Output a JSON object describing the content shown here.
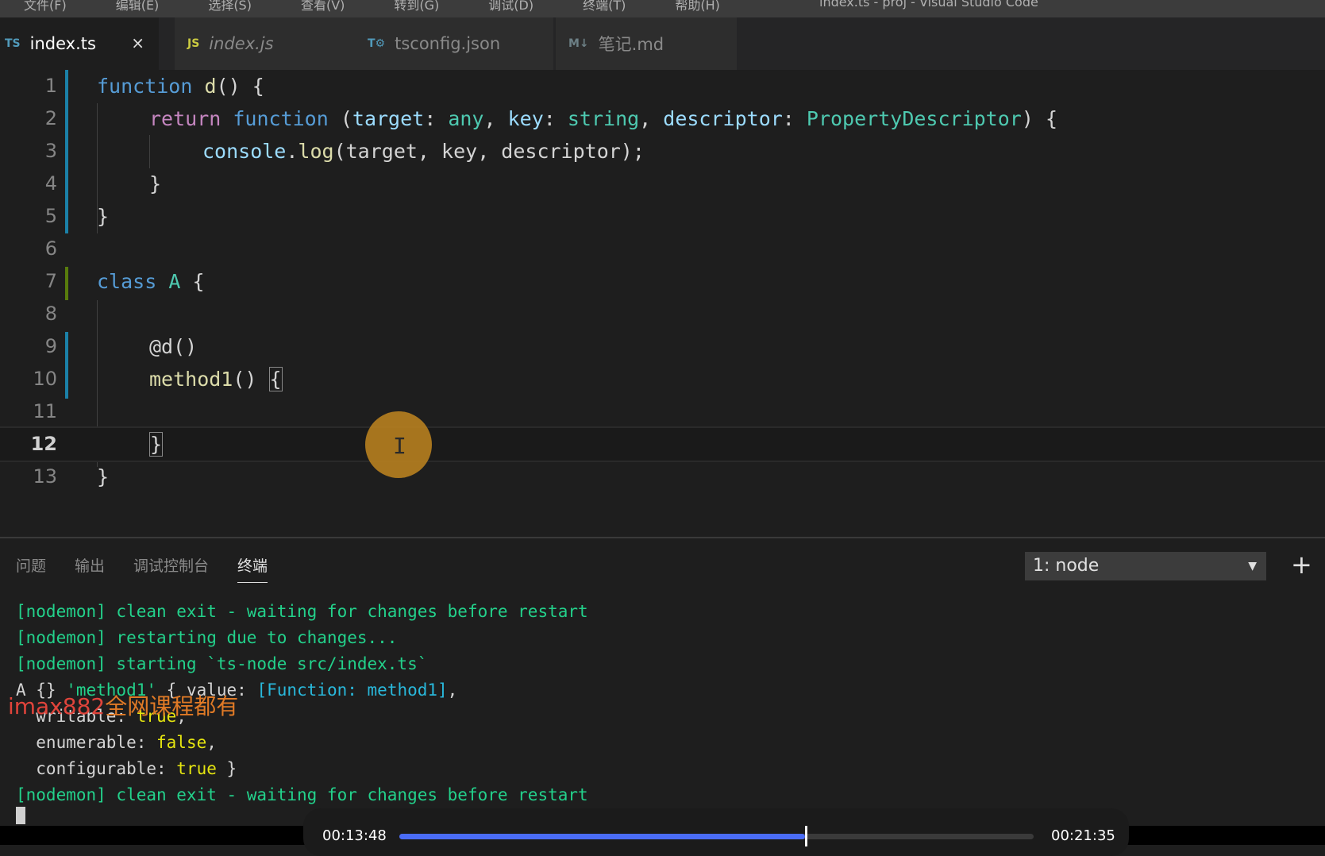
{
  "titlebar": {
    "menu": [
      "文件(F)",
      "编辑(E)",
      "选择(S)",
      "查看(V)",
      "转到(G)",
      "调试(D)",
      "终端(T)",
      "帮助(H)"
    ],
    "window_title": "index.ts - proj - Visual Studio Code"
  },
  "tabs": [
    {
      "icon": "TS",
      "icon_color": "#519aba",
      "label": "index.ts",
      "active": true,
      "close": "×"
    },
    {
      "icon": "JS",
      "icon_color": "#cbcb41",
      "label": "index.js",
      "active": false,
      "italic": true
    },
    {
      "icon": "T⚙",
      "icon_color": "#519aba",
      "label": "tsconfig.json",
      "active": false
    },
    {
      "icon": "M↓",
      "icon_color": "#6d8086",
      "label": "笔记.md",
      "active": false
    }
  ],
  "editor": {
    "current_line": 12,
    "lines": [
      {
        "n": "1"
      },
      {
        "n": "2"
      },
      {
        "n": "3"
      },
      {
        "n": "4"
      },
      {
        "n": "5"
      },
      {
        "n": "6"
      },
      {
        "n": "7"
      },
      {
        "n": "8"
      },
      {
        "n": "9"
      },
      {
        "n": "10"
      },
      {
        "n": "11"
      },
      {
        "n": "12"
      },
      {
        "n": "13"
      }
    ],
    "code": {
      "l1_kw": "function",
      "l1_fn": "d",
      "l1_rest": "() {",
      "l2_ret": "return",
      "l2_kw": "function",
      "l2_a": " (",
      "l2_p1": "target",
      "l2_t1": "any",
      "l2_p2": "key",
      "l2_t2": "string",
      "l2_p3": "descriptor",
      "l2_t3": "PropertyDescriptor",
      "l2_end": ") {",
      "l3_obj": "console",
      "l3_fn": "log",
      "l3_args": "(target, key, descriptor);",
      "l4": "}",
      "l5": "}",
      "l7_kw": "class",
      "l7_name": "A",
      "l7_rest": " {",
      "l9": "@d()",
      "l10_fn": "method1",
      "l10_rest": "() ",
      "l10_brace": "{",
      "l12": "}",
      "l13": "}"
    },
    "cursor_glyph": "I"
  },
  "panel": {
    "tabs": [
      "问题",
      "输出",
      "调试控制台",
      "终端"
    ],
    "active_tab": "终端",
    "terminal_select": "1: node",
    "add_icon": "+",
    "terminal": {
      "l1": "[nodemon] clean exit - waiting for changes before restart",
      "l2": "[nodemon] restarting due to changes...",
      "l3": "[nodemon] starting `ts-node src/index.ts`",
      "l4_a": "A {} ",
      "l4_b": "'method1'",
      "l4_c": " { value: ",
      "l4_d": "[Function: method1]",
      "l4_e": ",",
      "l5_a": "  writable: ",
      "l5_b": "true",
      "l5_c": ",",
      "l6_a": "  enumerable: ",
      "l6_b": "false",
      "l6_c": ",",
      "l7_a": "  configurable: ",
      "l7_b": "true",
      "l7_c": " }",
      "l8": "[nodemon] clean exit - waiting for changes before restart"
    }
  },
  "watermark": {
    "part1": "imax882",
    "part2": "全网课程都有"
  },
  "player": {
    "current_time": "00:13:48",
    "total_time": "00:21:35",
    "progress": 0.639
  }
}
